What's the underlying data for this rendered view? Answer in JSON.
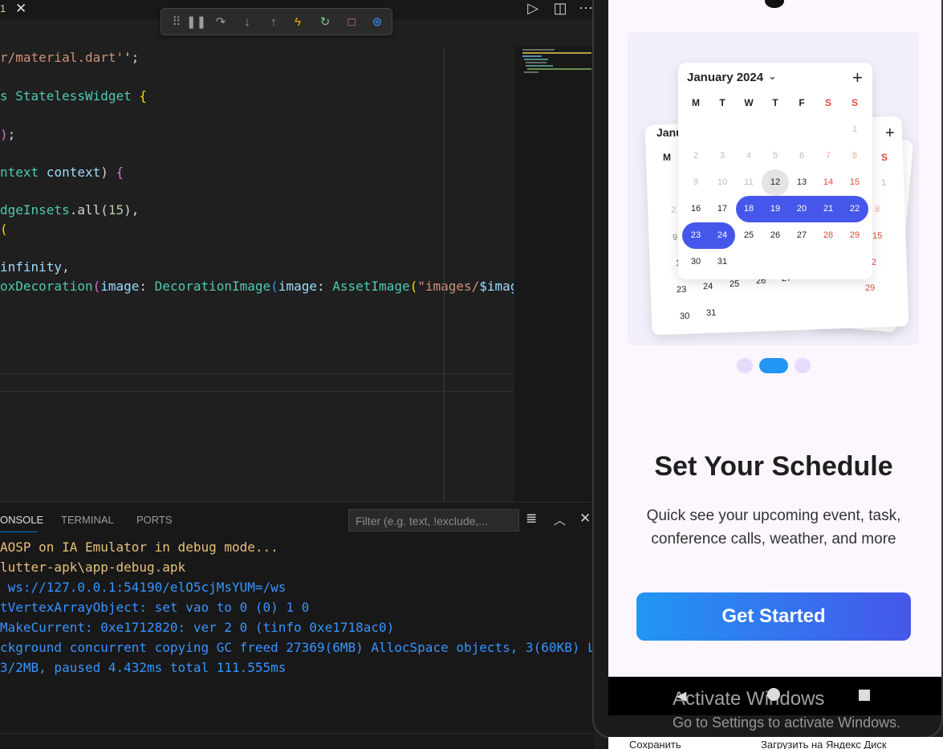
{
  "editor": {
    "tab_number": "1",
    "lines": [
      {
        "parts": [
          [
            "s",
            "r/material.dart'"
          ],
          [
            "",
            "';"
          ]
        ]
      },
      {
        "parts": [
          [
            "t",
            "s StatelessWidget"
          ],
          [
            "b",
            " {"
          ]
        ]
      },
      {
        "parts": [
          [
            "p",
            ")"
          ],
          [
            "",
            ";"
          ]
        ]
      },
      {
        "parts": [
          [
            "t",
            "ntext"
          ],
          [
            "v",
            " context"
          ],
          [
            "",
            ")"
          ],
          [
            "p",
            " {"
          ]
        ]
      },
      {
        "parts": [
          [
            "t",
            "dgeInsets"
          ],
          [
            "",
            ".all("
          ],
          [
            "n",
            "15"
          ],
          [
            "",
            "),"
          ]
        ]
      },
      {
        "parts": [
          [
            "b",
            "("
          ]
        ]
      },
      {
        "parts": [
          [
            "v",
            "infinity"
          ],
          [
            "",
            ","
          ]
        ]
      },
      {
        "parts": [
          [
            "t",
            "oxDecoration"
          ],
          [
            "p",
            "("
          ],
          [
            "v",
            "image"
          ],
          [
            "",
            ": "
          ],
          [
            "t",
            "DecorationImage"
          ],
          [
            "bl",
            "("
          ],
          [
            "v",
            "image"
          ],
          [
            "",
            ": "
          ],
          [
            "t",
            "AssetImage"
          ],
          [
            "b",
            "("
          ],
          [
            "s",
            "\"images/"
          ],
          [
            "v",
            "$image"
          ]
        ]
      }
    ]
  },
  "panel": {
    "tabs": [
      "ONSOLE",
      "TERMINAL",
      "PORTS"
    ],
    "filter_placeholder": "Filter (e.g. text, !exclude,...",
    "output": [
      {
        "text": "AOSP on IA Emulator in debug mode...",
        "kind": "yellow"
      },
      {
        "text": "lutter-apk\\app-debug.apk",
        "kind": "yellow"
      },
      {
        "text": " ws://127.0.0.1:54190/elO5cjMsYUM=/ws",
        "kind": "blue"
      },
      {
        "text": "tVertexArrayObject: set vao to 0 (0) 1 0",
        "kind": "blue"
      },
      {
        "text": "MakeCurrent: 0xe1712820: ver 2 0 (tinfo 0xe1718ac0)",
        "kind": "blue"
      },
      {
        "text": "ckground concurrent copying GC freed 27369(6MB) AllocSpace objects, 3(60KB) L",
        "kind": "blue"
      },
      {
        "text": "3/2MB, paused 4.432ms total 111.555ms",
        "kind": "blue"
      }
    ]
  },
  "phone": {
    "calendar": {
      "month": "January 2024",
      "weekdays": [
        "M",
        "T",
        "W",
        "T",
        "F",
        "S",
        "S"
      ],
      "back_month": "Janu",
      "back_weekday": "M",
      "back_weekend": "S"
    },
    "title": "Set Your Schedule",
    "subtitle_line1": "Quick see your upcoming event, task,",
    "subtitle_line2": "conference calls, weather, and more",
    "cta": "Get Started",
    "accent": "#4557ea"
  },
  "watermark": {
    "line1": "Activate Windows",
    "line2": "Go to Settings to activate Windows."
  },
  "taskbar": {
    "save": "Сохранить",
    "upload": "Загрузить на Яндекс Диск"
  }
}
